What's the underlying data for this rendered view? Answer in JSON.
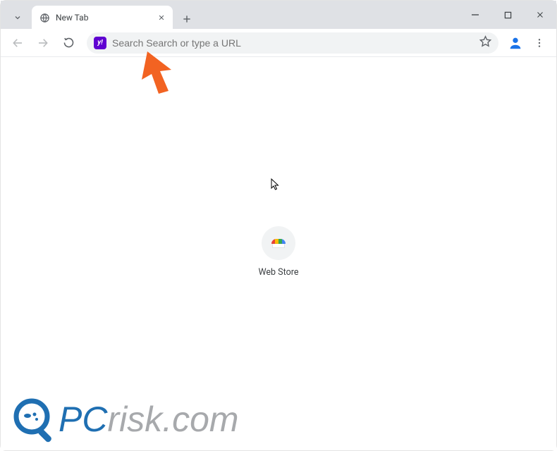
{
  "window": {
    "controls": {
      "minimize": "–",
      "maximize": "□",
      "close": "✕"
    }
  },
  "tab": {
    "title": "New Tab"
  },
  "toolbar": {
    "engine_badge": "y!",
    "url_placeholder": "Search Search or type a URL"
  },
  "shortcuts": [
    {
      "label": "Web Store"
    }
  ],
  "watermark": {
    "prefix": "PC",
    "suffix": "risk.com"
  },
  "colors": {
    "accent_engine": "#5f01d1",
    "annotation_arrow": "#f26322",
    "watermark_blue": "#1f6fb2",
    "watermark_grey": "#a7a9ac"
  }
}
